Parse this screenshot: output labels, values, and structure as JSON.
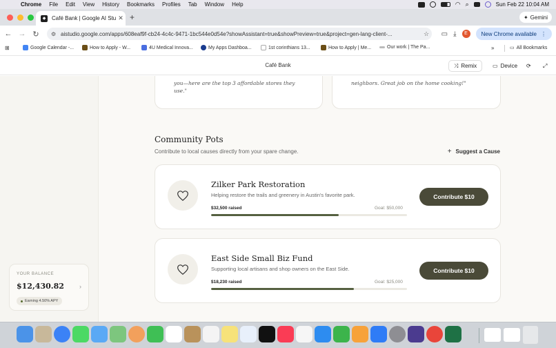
{
  "menubar": {
    "app": "Chrome",
    "items": [
      "File",
      "Edit",
      "View",
      "History",
      "Bookmarks",
      "Profiles",
      "Tab",
      "Window",
      "Help"
    ],
    "datetime": "Sun Feb 22  10:04 AM"
  },
  "browser": {
    "tab_title": "Café Bank | Google AI Studio",
    "gemini_label": "Gemini",
    "url": "aistudio.google.com/apps/608eaf9f-cb24-4c4c-9471-1bc544e0d54e?showAssistant=true&showPreview=true&project=gen-lang-client-...",
    "profile_initial": "E",
    "update_label": "New Chrome available",
    "bookmarks": [
      "Google Calendar -...",
      "How to Apply - W...",
      "4U Medical Innova...",
      "My Apps Dashboa...",
      "1st corinthians 13...",
      "How to Apply | Me...",
      "Our work | The Pa..."
    ],
    "all_bookmarks": "All Bookmarks"
  },
  "studio_header": {
    "title": "Café Bank",
    "remix": "Remix",
    "device": "Device"
  },
  "testimonials": [
    "you—here are the top 3 affordable stores they use.\"",
    "neighbors. Great job on the home cooking!\""
  ],
  "community": {
    "title": "Community Pots",
    "subtitle": "Contribute to local causes directly from your spare change.",
    "suggest": "Suggest a Cause",
    "pots": [
      {
        "name": "Zilker Park Restoration",
        "description": "Helping restore the trails and greenery in Austin's favorite park.",
        "raised": "$32,500 raised",
        "goal": "Goal: $50,000",
        "progress": 0.65,
        "cta": "Contribute $10"
      },
      {
        "name": "East Side Small Biz Fund",
        "description": "Supporting local artisans and shop owners on the East Side.",
        "raised": "$18,230 raised",
        "goal": "Goal: $25,000",
        "progress": 0.729,
        "cta": "Contribute $10"
      }
    ]
  },
  "balance": {
    "label": "YOUR BALANCE",
    "amount": "$12,430.82",
    "apy": "Earning 4.50% APY"
  },
  "colors": {
    "cta": "#4a4a38",
    "progress": "#556040",
    "page_bg": "#faf9f6"
  }
}
